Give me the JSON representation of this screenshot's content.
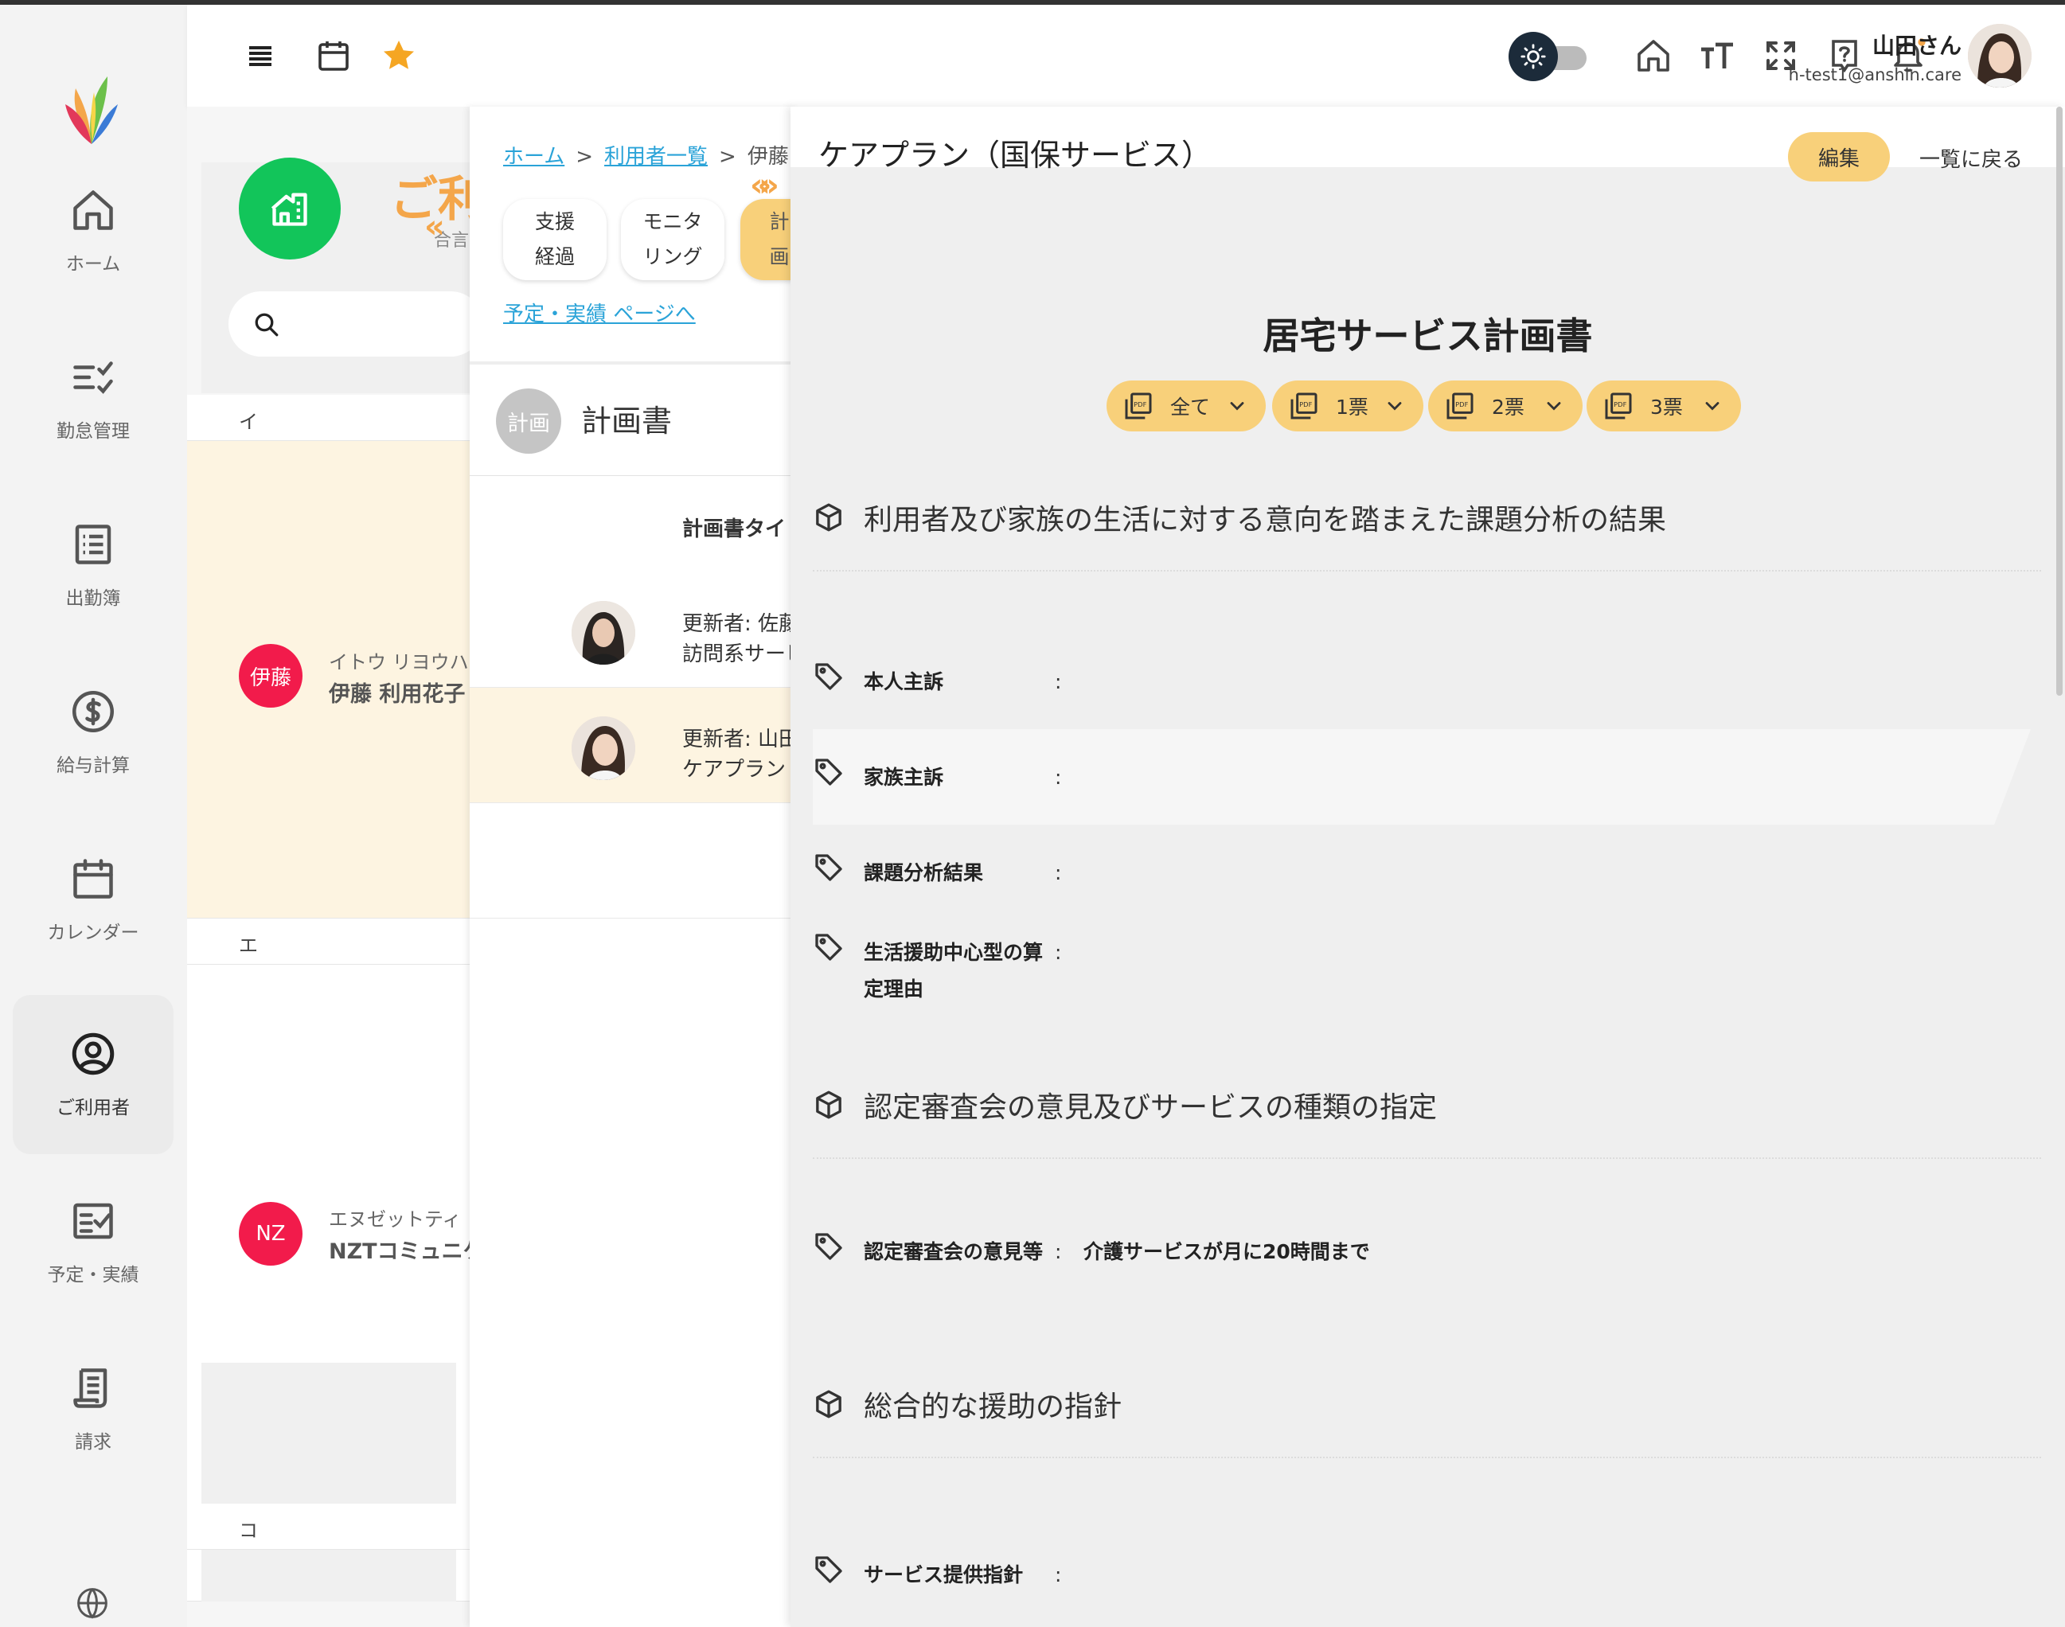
{
  "sidebar": {
    "items": [
      {
        "label": "ホーム",
        "icon": "home-icon"
      },
      {
        "label": "勤怠管理",
        "icon": "checklist-icon"
      },
      {
        "label": "出勤簿",
        "icon": "list-icon"
      },
      {
        "label": "給与計算",
        "icon": "dollar-icon"
      },
      {
        "label": "カレンダー",
        "icon": "calendar-icon"
      },
      {
        "label": "ご利用者",
        "icon": "user-circle-icon"
      },
      {
        "label": "予定・実績",
        "icon": "schedule-icon"
      },
      {
        "label": "請求",
        "icon": "receipt-icon"
      }
    ]
  },
  "header": {
    "user_name": "山田さん",
    "user_email": "h-test1@anshin.care"
  },
  "panel1": {
    "title": "ご利",
    "subtitle": "合言",
    "sections": [
      {
        "kana": "イ"
      },
      {
        "kana": "エ"
      },
      {
        "kana": "コ"
      }
    ],
    "users": [
      {
        "badge": "伊藤",
        "kana_name": "イトウ リヨウハ",
        "name": "伊藤 利用花子"
      },
      {
        "badge": "NZ",
        "kana_name": "エヌゼットティ",
        "name": "NZTコミュニケ"
      }
    ]
  },
  "panel2": {
    "breadcrumb": {
      "home": "ホーム",
      "sep": ">",
      "list": "利用者一覧",
      "current": "伊藤"
    },
    "tabs": [
      {
        "label_line1": "支援",
        "label_line2": "経過"
      },
      {
        "label_line1": "モニタ",
        "label_line2": "リング"
      },
      {
        "label_line1": "計画",
        "label_line2": ""
      }
    ],
    "link": "予定・実績 ページへ",
    "plan_badge": "計画",
    "heading": "計画書",
    "column_header": "計画書タイ",
    "items": [
      {
        "line1": "更新者: 佐藤",
        "line2": "訪問系サービス"
      },
      {
        "line1": "更新者: 山田",
        "line2": "ケアプラン"
      }
    ]
  },
  "panel3": {
    "title": "ケアプラン（国保サービス）",
    "edit_label": "編集",
    "back_label": "一覧に戻る",
    "doc_title": "居宅サービス計画書",
    "pdf_buttons": [
      "全て",
      "1票",
      "2票",
      "3票"
    ],
    "sections": [
      {
        "heading": "利用者及び家族の生活に対する意向を踏まえた課題分析の結果",
        "fields": [
          {
            "label": "本人主訴",
            "value": ""
          },
          {
            "label": "家族主訴",
            "value": ""
          },
          {
            "label": "課題分析結果",
            "value": ""
          },
          {
            "label": "生活援助中心型の算定理由",
            "value": ""
          }
        ]
      },
      {
        "heading": "認定審査会の意見及びサービスの種類の指定",
        "fields": [
          {
            "label": "認定審査会の意見等",
            "value": "介護サービスが月に20時間まで"
          }
        ]
      },
      {
        "heading": "総合的な援助の指針",
        "fields": [
          {
            "label": "サービス提供指針",
            "value": ""
          }
        ]
      }
    ],
    "colon": ":"
  },
  "colors": {
    "accent_yellow": "#f8d07a",
    "accent_orange": "#f4a64a",
    "brand_green": "#12c55a",
    "user_red": "#f21b4b",
    "link_blue": "#2aa3d8"
  }
}
